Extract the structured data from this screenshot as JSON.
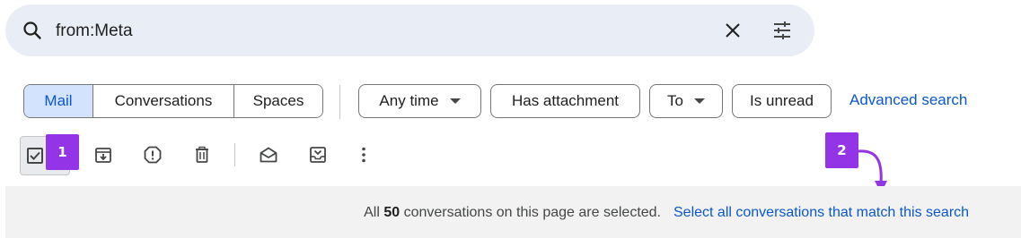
{
  "search": {
    "query": "from:Meta"
  },
  "filters": {
    "segments": [
      "Mail",
      "Conversations",
      "Spaces"
    ],
    "any_time": "Any time",
    "has_attachment": "Has attachment",
    "to": "To",
    "is_unread": "Is unread",
    "advanced_search": "Advanced search"
  },
  "toolbar": {
    "icons": [
      "select-all-checkbox",
      "archive-icon",
      "report-spam-icon",
      "delete-icon",
      "mark-as-unread-icon",
      "move-to-inbox-icon",
      "more-options-icon"
    ]
  },
  "annotations": {
    "badge1": "1",
    "badge2": "2",
    "badge_color": "#9334e6"
  },
  "banner": {
    "prefix": "All ",
    "count": "50",
    "suffix": " conversations on this page are selected.",
    "select_all_link": "Select all conversations that match this search"
  },
  "colors": {
    "accent": "#0b57d0",
    "selected_segment_bg": "#d3e3fd",
    "search_bg": "#e9eef6",
    "banner_bg": "#f2f2f2"
  }
}
